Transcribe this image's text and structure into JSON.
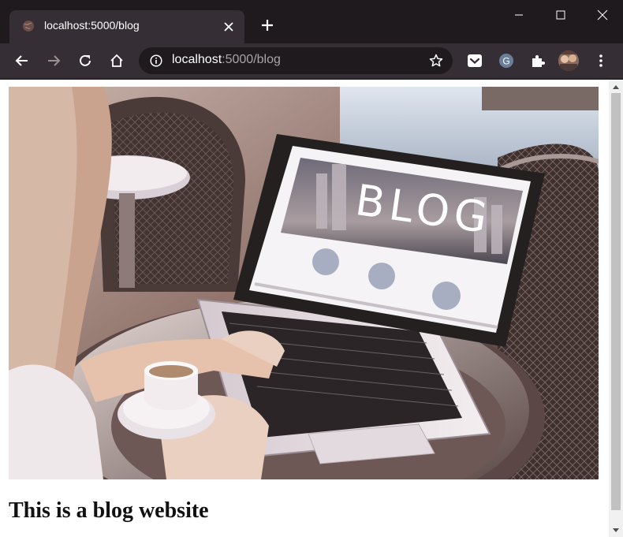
{
  "browser": {
    "tab": {
      "title": "localhost:5000/blog",
      "favicon": "globe-icon"
    },
    "omnibox": {
      "url_host": "localhost",
      "url_path": ":5000/blog"
    },
    "toolbar_icons": [
      "back-arrow-icon",
      "forward-arrow-icon",
      "reload-icon",
      "home-icon",
      "star-icon",
      "extension-pocket-icon",
      "extension-g-icon",
      "puzzle-icon",
      "profile-avatar",
      "menu-dots-icon"
    ],
    "window_controls": [
      "minimize-icon",
      "maximize-icon",
      "close-icon"
    ]
  },
  "page": {
    "hero_image": {
      "laptop_screen_text": "BLOG"
    },
    "heading": "This is a blog website"
  },
  "colors": {
    "tabstrip": "#1e1a1e",
    "toolbar": "#352f35",
    "page_bg": "#ffffff",
    "heading_text": "#111111"
  }
}
